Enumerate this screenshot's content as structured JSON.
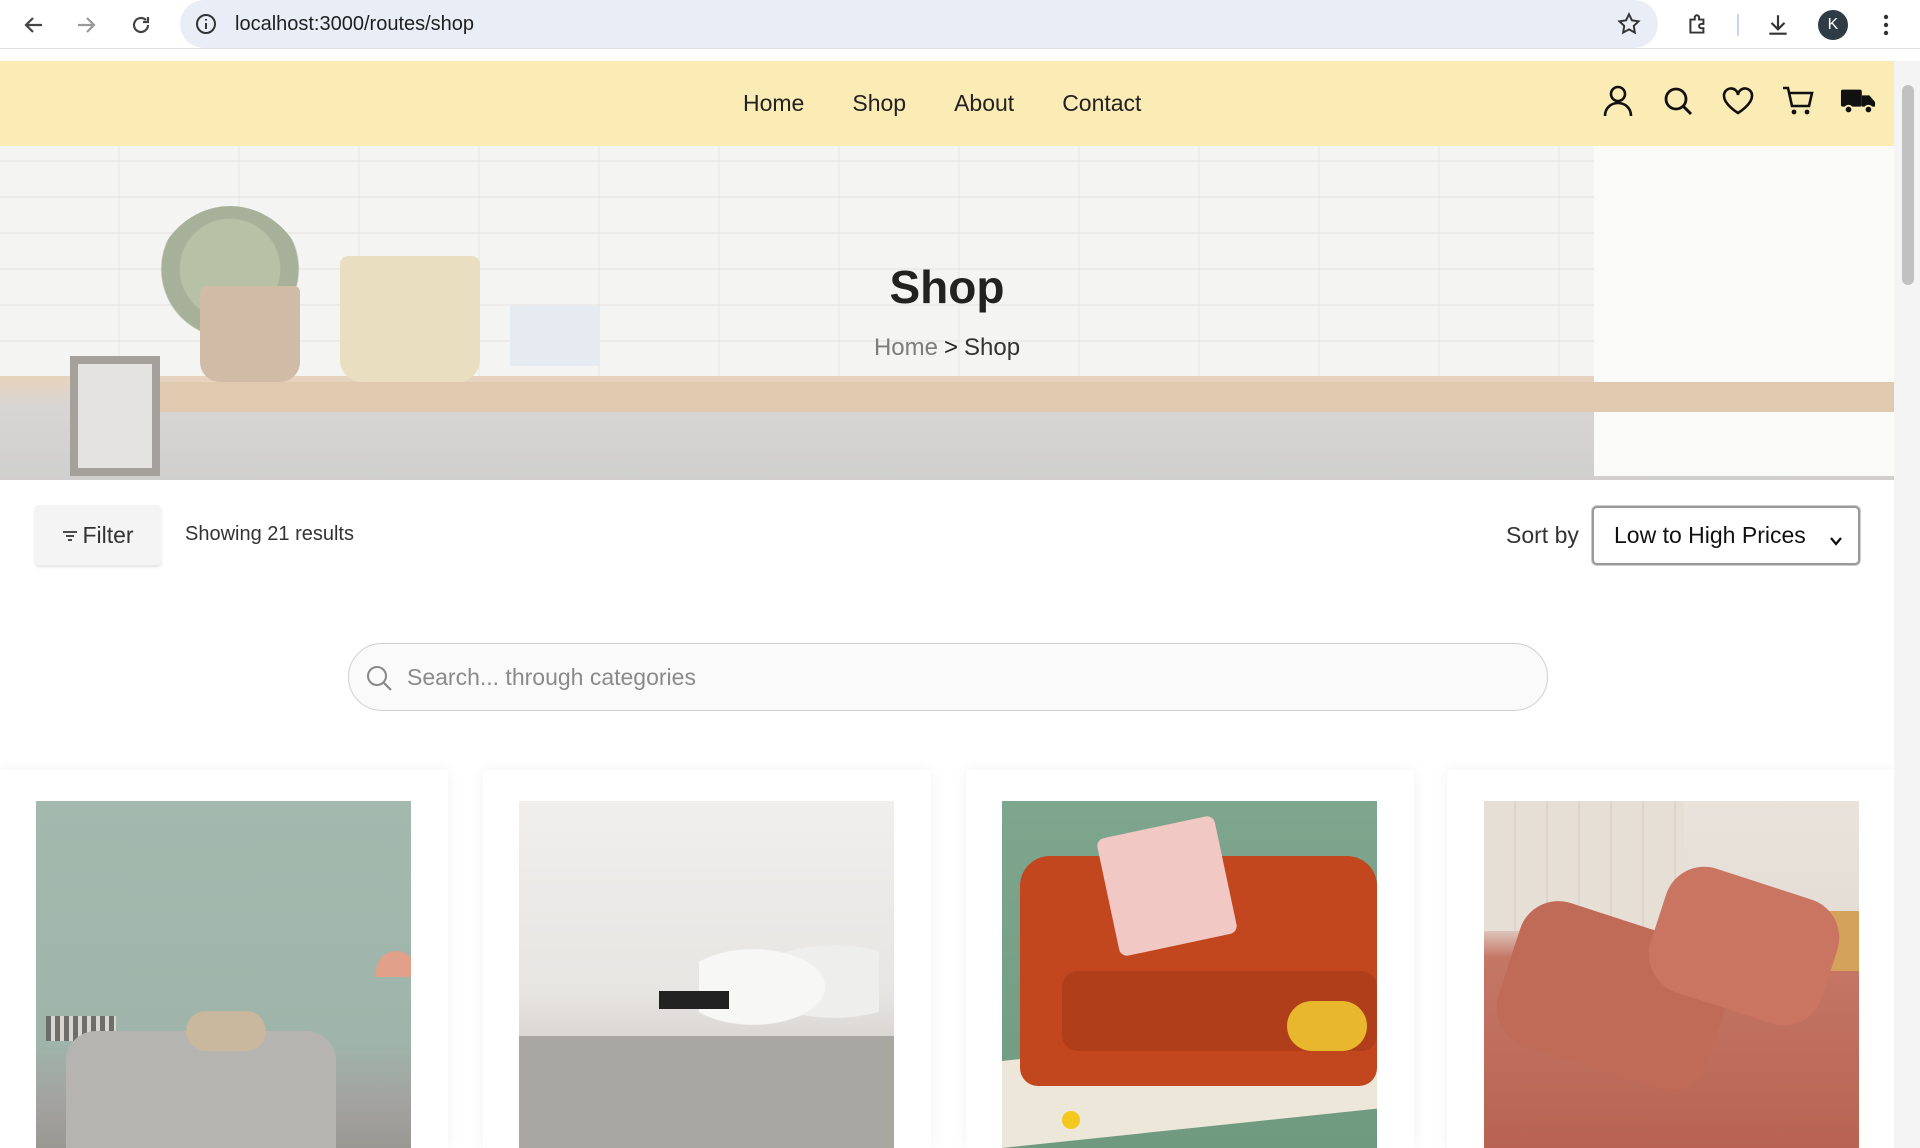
{
  "browser": {
    "url": "localhost:3000/routes/shop",
    "profile_initial": "K"
  },
  "header": {
    "nav": [
      "Home",
      "Shop",
      "About",
      "Contact"
    ],
    "icons": [
      "user-icon",
      "search-icon",
      "heart-icon",
      "cart-icon",
      "truck-icon"
    ]
  },
  "hero": {
    "title": "Shop",
    "breadcrumb": {
      "home": "Home",
      "separator": ">",
      "current": "Shop"
    }
  },
  "toolbar": {
    "filter_label": "Filter",
    "results_text": "Showing 21 results",
    "sort_label": "Sort by",
    "sort_value": "Low to High Prices"
  },
  "search": {
    "placeholder": "Search... through categories"
  },
  "colors": {
    "header_bg": "#fbebb5",
    "accent": "#222222"
  }
}
